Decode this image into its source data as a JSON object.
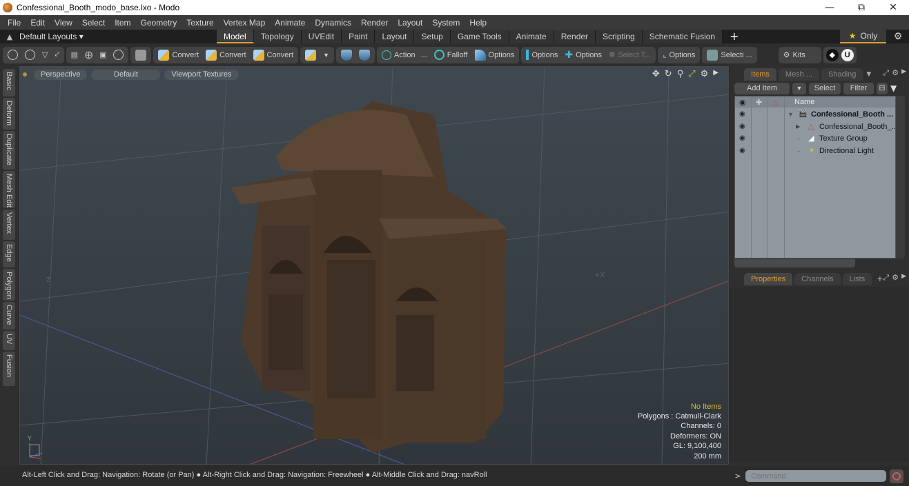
{
  "window": {
    "title": "Confessional_Booth_modo_base.lxo - Modo",
    "controls": [
      "minimize",
      "restore",
      "close"
    ]
  },
  "menubar": [
    "File",
    "Edit",
    "View",
    "Select",
    "Item",
    "Geometry",
    "Texture",
    "Vertex Map",
    "Animate",
    "Dynamics",
    "Render",
    "Layout",
    "System",
    "Help"
  ],
  "layoutbar": {
    "layouts_dropdown": "Default Layouts ▾",
    "tabs": [
      "Model",
      "Topology",
      "UVEdit",
      "Paint",
      "Layout",
      "Setup",
      "Game Tools",
      "Animate",
      "Render",
      "Scripting",
      "Schematic Fusion"
    ],
    "active_tab": "Model",
    "only_label": "Only",
    "accent_color": "#e49a34"
  },
  "toolbar": {
    "convert1": "Convert",
    "convert2": "Convert",
    "convert3": "Convert",
    "action": "Action",
    "action_more": "...",
    "falloff": "Falloff",
    "options1": "Options",
    "options2": "Options",
    "options3": "Options",
    "select_t": "Select T...",
    "options4": "Options",
    "selecti": "Selecti ...",
    "kits": "Kits"
  },
  "sidetabs": [
    "Basic",
    "Deform",
    "Duplicate",
    "Mesh Edit",
    "Vertex",
    "Edge",
    "Polygon",
    "Curve",
    "UV",
    "Fusion"
  ],
  "viewport": {
    "view": "Perspective",
    "shading": "Default",
    "textures": "Viewport Textures",
    "axis_z": "Z",
    "axis_x": "+X",
    "info": {
      "items": "No Items",
      "polygons": "Polygons : Catmull-Clark",
      "channels": "Channels: 0",
      "deformers": "Deformers: ON",
      "gl": "GL: 9,100,400",
      "scale": "200 mm"
    }
  },
  "items_panel": {
    "tabs": [
      "Items",
      "Mesh ...",
      "Shading"
    ],
    "active_tab": "Items",
    "add_item": "Add Item",
    "select": "Select",
    "filter": "Filter",
    "name_header": "Name",
    "tree": [
      {
        "label": "Confessional_Booth ...",
        "level": 0,
        "type": "scene",
        "bold": true,
        "expanded": true
      },
      {
        "label": "Confessional_Booth_...",
        "level": 1,
        "type": "mesh",
        "collapsed": true
      },
      {
        "label": "Texture Group",
        "level": 1,
        "type": "texture-group"
      },
      {
        "label": "Directional Light",
        "level": 1,
        "type": "light"
      }
    ]
  },
  "properties_panel": {
    "tabs": [
      "Properties",
      "Channels",
      "Lists"
    ],
    "active_tab": "Properties"
  },
  "command": {
    "prompt": ">",
    "placeholder": "Command"
  },
  "statusbar": {
    "hint1": "Alt-Left Click and Drag: Navigation: Rotate (or Pan)",
    "hint2": "Alt-Right Click and Drag: Navigation: Freewheel",
    "hint3": "Alt-Middle Click and Drag: navRoll"
  }
}
